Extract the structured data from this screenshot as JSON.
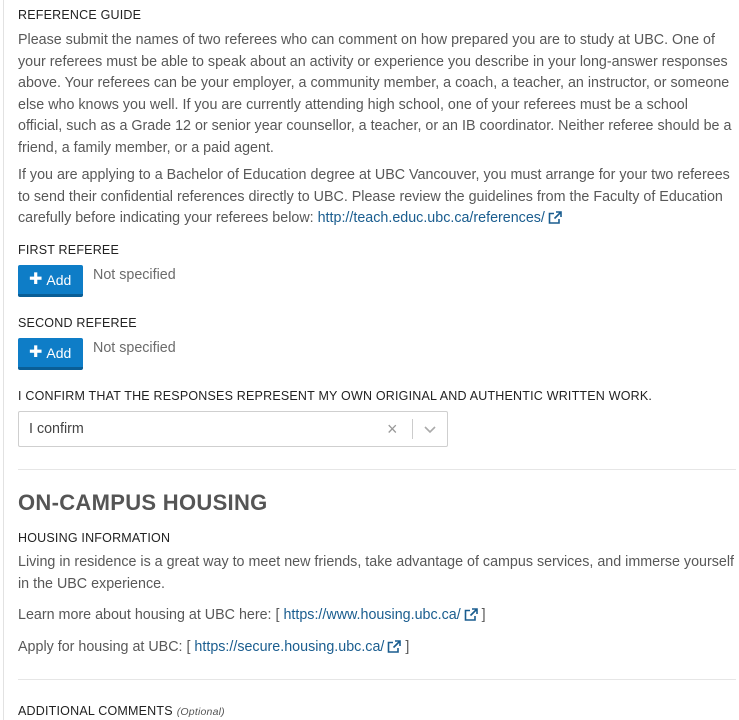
{
  "reference_guide": {
    "heading": "REFERENCE GUIDE",
    "para1": "Please submit the names of two referees who can comment on how prepared you are to study at UBC. One of your referees must be able to speak about an activity or experience you describe in your long-answer responses above. Your referees can be your employer, a community member, a coach, a teacher, an instructor, or someone else who knows you well. If you are currently attending high school, one of your referees must be a school official, such as a Grade 12 or senior year counsellor, a teacher, or an IB coordinator. Neither referee should be a friend, a family member, or a paid agent.",
    "para2_text": "If you are applying to a Bachelor of Education degree at UBC Vancouver, you must arrange for your two referees to send their confidential references directly to UBC. Please review the guidelines from the Faculty of Education carefully before indicating your referees below: ",
    "para2_link": "http://teach.educ.ubc.ca/references/"
  },
  "first_referee": {
    "heading": "FIRST REFEREE",
    "add_label": "Add",
    "status": "Not specified"
  },
  "second_referee": {
    "heading": "SECOND REFEREE",
    "add_label": "Add",
    "status": "Not specified"
  },
  "confirm": {
    "heading": "I CONFIRM THAT THE RESPONSES REPRESENT MY OWN ORIGINAL AND AUTHENTIC WRITTEN WORK.",
    "selected": "I confirm"
  },
  "housing": {
    "title": "ON-CAMPUS HOUSING",
    "info_heading": "HOUSING INFORMATION",
    "para1": "Living in residence is a great way to meet new friends, take advantage of campus services, and immerse yourself in the UBC experience.",
    "learn_prefix": "Learn more about housing at UBC here: [ ",
    "learn_link": "https://www.housing.ubc.ca/",
    "learn_suffix": " ]",
    "apply_prefix": "Apply for housing at UBC: [ ",
    "apply_link": "https://secure.housing.ubc.ca/",
    "apply_suffix": " ]"
  },
  "additional": {
    "heading": "ADDITIONAL COMMENTS",
    "optional": "(Optional)"
  },
  "colors": {
    "accent": "#0e7dc7",
    "link": "#1a5d8f"
  },
  "icons": {
    "external": "external-link-icon",
    "plus": "plus-icon",
    "clear": "clear-icon",
    "dropdown": "chevron-down-icon"
  }
}
